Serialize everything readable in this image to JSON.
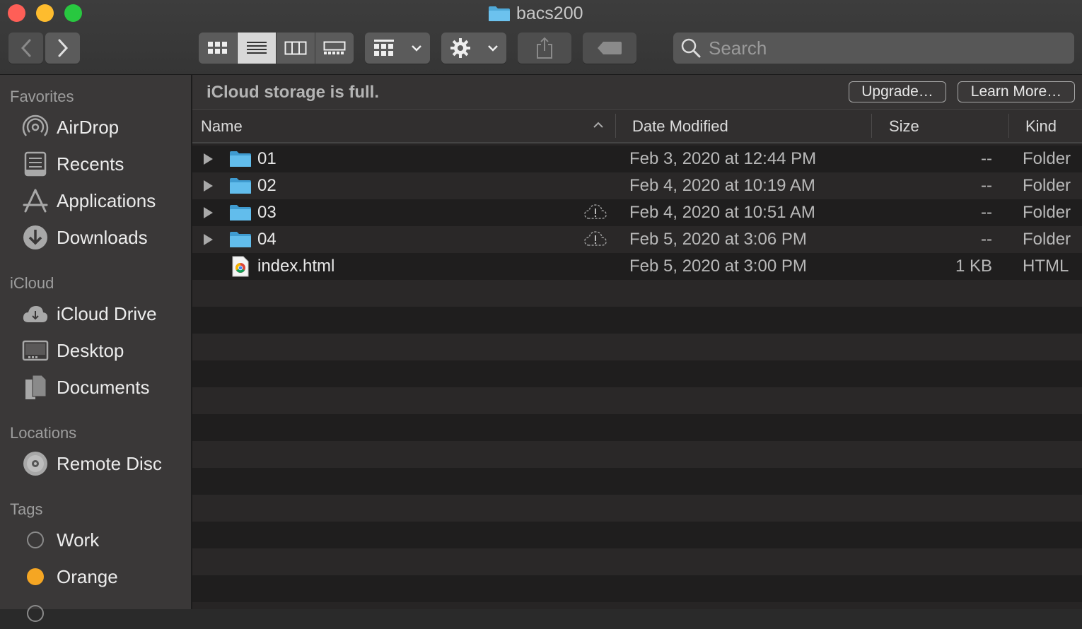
{
  "window": {
    "title": "bacs200"
  },
  "toolbar": {
    "search_placeholder": "Search"
  },
  "sidebar": {
    "sections": [
      {
        "heading": "Favorites",
        "items": [
          {
            "label": "AirDrop",
            "icon": "airdrop-icon"
          },
          {
            "label": "Recents",
            "icon": "recents-icon"
          },
          {
            "label": "Applications",
            "icon": "applications-icon"
          },
          {
            "label": "Downloads",
            "icon": "downloads-icon"
          }
        ]
      },
      {
        "heading": "iCloud",
        "items": [
          {
            "label": "iCloud Drive",
            "icon": "icloud-icon"
          },
          {
            "label": "Desktop",
            "icon": "desktop-icon"
          },
          {
            "label": "Documents",
            "icon": "documents-icon"
          }
        ]
      },
      {
        "heading": "Locations",
        "items": [
          {
            "label": "Remote Disc",
            "icon": "disc-icon"
          }
        ]
      },
      {
        "heading": "Tags",
        "items": [
          {
            "label": "Work",
            "icon": "tag-empty-icon"
          },
          {
            "label": "Orange",
            "icon": "tag-orange-icon",
            "color": "#f5a623"
          }
        ]
      }
    ]
  },
  "banner": {
    "text": "iCloud storage is full.",
    "upgrade_label": "Upgrade…",
    "learn_more_label": "Learn More…"
  },
  "columns": {
    "name": "Name",
    "date": "Date Modified",
    "size": "Size",
    "kind": "Kind"
  },
  "files": [
    {
      "name": "01",
      "date": "Feb 3, 2020 at 12:44 PM",
      "size": "--",
      "kind": "Folder",
      "type": "folder",
      "cloud_warning": false
    },
    {
      "name": "02",
      "date": "Feb 4, 2020 at 10:19 AM",
      "size": "--",
      "kind": "Folder",
      "type": "folder",
      "cloud_warning": false
    },
    {
      "name": "03",
      "date": "Feb 4, 2020 at 10:51 AM",
      "size": "--",
      "kind": "Folder",
      "type": "folder",
      "cloud_warning": true
    },
    {
      "name": "04",
      "date": "Feb 5, 2020 at 3:06 PM",
      "size": "--",
      "kind": "Folder",
      "type": "folder",
      "cloud_warning": true
    },
    {
      "name": "index.html",
      "date": "Feb 5, 2020 at 3:00 PM",
      "size": "1 KB",
      "kind": "HTML",
      "type": "html",
      "cloud_warning": false
    }
  ]
}
